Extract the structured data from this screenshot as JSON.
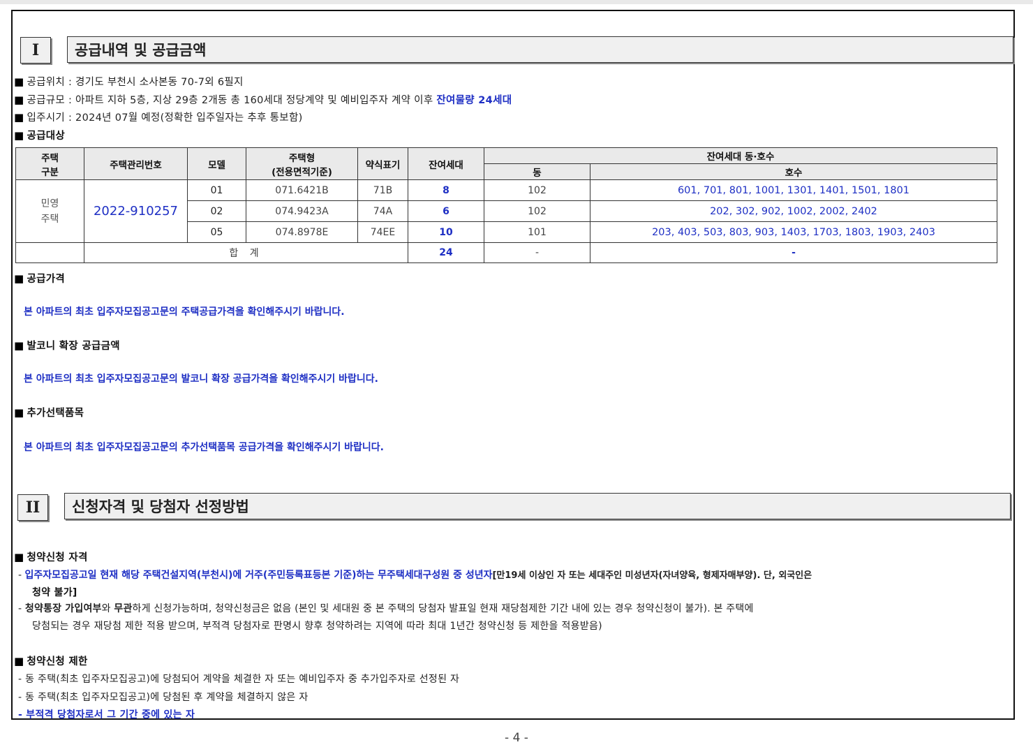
{
  "section1": {
    "number": "I",
    "title": "공급내역 및 공급금액"
  },
  "info": {
    "location": "공급위치 : 경기도 부천시 소사본동 70-7외 6필지",
    "scale_prefix": "공급규모 : 아파트 지하 5층, 지상 29층 2개동 총 160세대 정당계약 및 예비입주자 계약 이후",
    "scale_highlight": "잔여물량 24세대",
    "movein": "입주시기 : 2024년 07월 예정(정확한 입주일자는 추후 통보함)",
    "target_heading": "공급대상"
  },
  "table": {
    "headers": {
      "house_type_1": "주택",
      "house_type_2": "구분",
      "mgmt_no": "주택관리번호",
      "model": "모델",
      "size_1": "주택형",
      "size_2": "(전용면적기준)",
      "abbr": "약식표기",
      "remaining": "잔여세대",
      "units_group": "잔여세대 동·호수",
      "dong": "동",
      "ho": "호수"
    },
    "house_type_1": "민영",
    "house_type_2": "주택",
    "mgmt_no": "2022-910257",
    "rows": [
      {
        "model": "01",
        "size": "071.6421B",
        "abbr": "71B",
        "remaining": "8",
        "dong": "102",
        "units": "601, 701, 801, 1001, 1301, 1401, 1501, 1801"
      },
      {
        "model": "02",
        "size": "074.9423A",
        "abbr": "74A",
        "remaining": "6",
        "dong": "102",
        "units": "202, 302, 902, 1002, 2002, 2402"
      },
      {
        "model": "05",
        "size": "074.8978E",
        "abbr": "74EE",
        "remaining": "10",
        "dong": "101",
        "units": "203, 403, 503, 803, 903, 1403, 1703, 1803, 1903, 2403"
      }
    ],
    "total": {
      "label": "합 계",
      "remaining": "24",
      "dong": "-",
      "units": "-"
    }
  },
  "price": {
    "heading": "공급가격",
    "note": "본 아파트의 최초 입주자모집공고문의 주택공급가격을 확인해주시기 바랍니다."
  },
  "balcony": {
    "heading": "발코니 확장 공급금액",
    "note": "본 아파트의 최초 입주자모집공고문의 발코니 확장 공급가격을 확인해주시기 바랍니다."
  },
  "options": {
    "heading": "추가선택품목",
    "note": "본 아파트의 최초 입주자모집공고문의 추가선택품목 공급가격을 확인해주시기 바랍니다."
  },
  "section2": {
    "number": "II",
    "title": "신청자격 및 당첨자 선정방법"
  },
  "eligibility": {
    "heading": "청약신청 자격",
    "line1_blue": "입주자모집공고일 현재 해당 주택건설지역(부천시)에 거주(주민등록표등본 기준)하는 무주택세대구성원 중 성년자",
    "line1_black": "[만19세 이상인 자 또는 세대주인 미성년자(자녀양육, 형제자매부양). 단, 외국인은",
    "line1_cont": "청약 불가]",
    "line2_b1": "청약통장 가입여부",
    "line2_t1": "와",
    "line2_b2": "무관",
    "line2_t2": "하게 신청가능하며, 청약신청금은 없음 (본인 및 세대원 중 본 주택의 당첨자 발표일 현재 재당첨제한 기간 내에 있는 경우 청약신청이 불가). 본 주택에",
    "line2_cont": "당첨되는 경우 재당첨 제한 적용 받으며, 부적격 당첨자로 판명시 향후 청약하려는 지역에 따라 최대 1년간 청약신청 등 제한을 적용받음)"
  },
  "restriction": {
    "heading": "청약신청 제한",
    "items": [
      "동 주택(최초 입주자모집공고)에 당첨되어 계약을 체결한 자 또는 예비입주자 중 추가입주자로 선정된 자",
      "동 주택(최초 입주자모집공고)에 당첨된 후 계약을 체결하지 않은 자",
      "부적격 당첨자로서 그 기간 중에 있는 자"
    ]
  },
  "page_number": "- 4 -"
}
